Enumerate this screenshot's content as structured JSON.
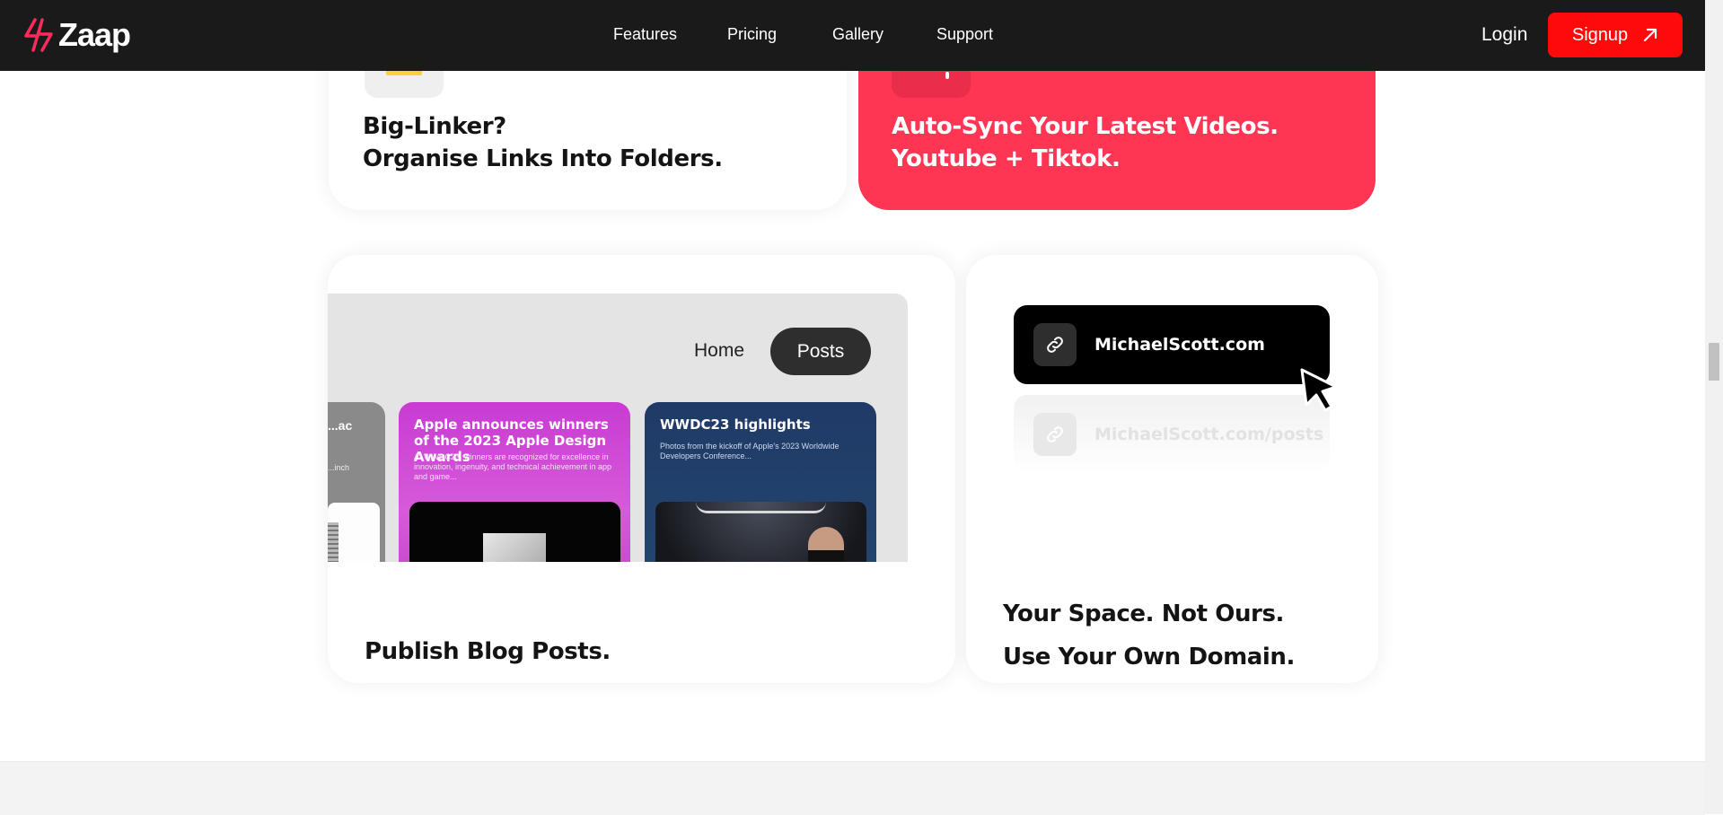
{
  "nav": {
    "brand": "Zaap",
    "links": [
      "Features",
      "Pricing",
      "Gallery",
      "Support"
    ],
    "login_label": "Login",
    "signup_label": "Signup"
  },
  "cards": {
    "folders": {
      "line1": "Big-Linker?",
      "line2": "Organise Links Into Folders."
    },
    "autosync": {
      "line1": "Auto-Sync Your Latest Videos.",
      "line2": "Youtube + Tiktok."
    },
    "blog": {
      "nav_home": "Home",
      "nav_posts": "Posts",
      "post_left_title": "...ac",
      "post_left_sub": "...inch",
      "post_center_title": "Apple announces winners of the 2023 Apple Design Awards",
      "post_center_sub": "At WWDC23, winners are recognized for excellence in innovation, ingenuity, and technical achievement in app and game...",
      "post_right_title": "WWDC23 highlights",
      "post_right_sub": "Photos from the kickoff of Apple's 2023 Worldwide Developers Conference...",
      "caption": "Publish Blog Posts."
    },
    "domain": {
      "primary_url": "MichaelScott.com",
      "secondary_url": "MichaelScott.com/posts",
      "line1": "Your Space. Not Ours.",
      "line2": "Use Your Own Domain."
    }
  },
  "colors": {
    "nav_bg": "#1a1a1a",
    "signup_bg": "#ff0a0a",
    "autosync_bg": "#ff3554",
    "brand_accent": "#ff2a5a"
  },
  "icons": [
    "zaap-logo-icon",
    "arrow-up-right-icon",
    "link-icon",
    "cursor-pointer-icon"
  ]
}
